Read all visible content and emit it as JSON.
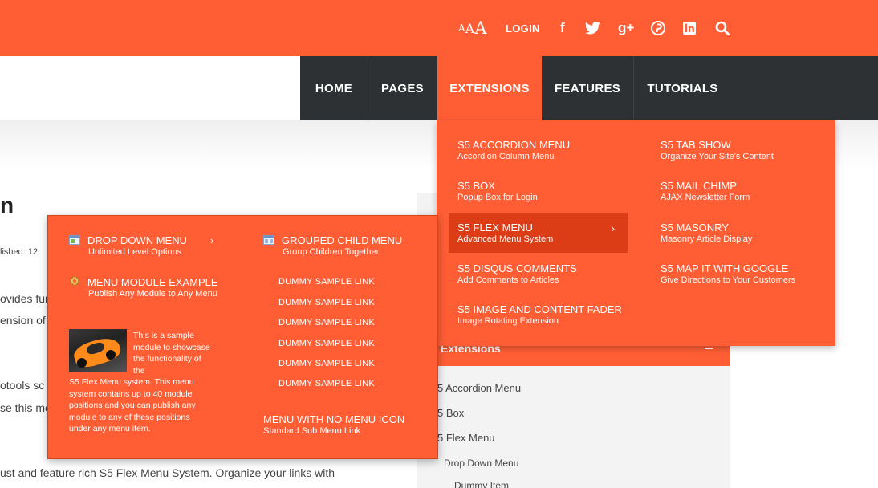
{
  "topbar": {
    "font_size": {
      "small": "A",
      "medium": "A",
      "large": "A"
    },
    "login": "LOGIN",
    "social_icons": [
      "facebook-icon",
      "twitter-icon",
      "google-plus-icon",
      "pinterest-icon",
      "linkedin-icon",
      "search-icon"
    ],
    "glyphs": {
      "facebook": "f",
      "twitter": "🐦",
      "google": "g+",
      "pinterest": "ⓟ",
      "linkedin": "in",
      "search": "⚲"
    }
  },
  "nav": {
    "items": [
      "HOME",
      "PAGES",
      "EXTENSIONS",
      "FEATURES",
      "TUTORIALS"
    ],
    "active": "EXTENSIONS"
  },
  "page": {
    "heading_fragment": "n",
    "published": "lished: 12",
    "line1": "ovides fun",
    "line2": "ension of",
    "line3": "otools sc",
    "line4": "se this me",
    "line5": "ust and feature rich S5 Flex Menu System. Organize your links with"
  },
  "sidebar": {
    "header": "Extensions",
    "links": [
      "5 Accordion Menu",
      "5 Box",
      "5 Flex Menu",
      "Drop Down Menu",
      "Dummy Item"
    ]
  },
  "dropdown": {
    "left": [
      {
        "title": "S5 Accordion Menu",
        "sub": "Accordion Column Menu"
      },
      {
        "title": "S5 Box",
        "sub": "Popup Box for Login"
      },
      {
        "title": "S5 Flex Menu",
        "sub": "Advanced Menu System"
      },
      {
        "title": "S5 Disqus Comments",
        "sub": "Add Comments to Articles"
      },
      {
        "title": "S5 Image and Content Fader",
        "sub": "Image Rotating Extension"
      }
    ],
    "right": [
      {
        "title": "S5 Tab Show",
        "sub": "Organize Your Site's Content"
      },
      {
        "title": "S5 Mail Chimp",
        "sub": "AJAX Newsletter Form"
      },
      {
        "title": "S5 Masonry",
        "sub": "Masonry Article Display"
      },
      {
        "title": "S5 Map It With Google",
        "sub": "Give Directions to Your Customers"
      }
    ],
    "arrow": "›"
  },
  "submenu": {
    "drop_down": {
      "title": "Drop Down Menu",
      "sub": "Unlimited Level Options",
      "arrow": "›"
    },
    "module_example": {
      "title": "Menu Module Example",
      "sub": "Publish Any Module to Any Menu"
    },
    "sample_text_top": "This is a sample module to showcase the functionality of the",
    "sample_text_bottom": "S5 Flex Menu system. This menu system contains up to 40 module positions and you can publish any module to any of these positions under any menu item.",
    "grouped": {
      "title": "Grouped Child Menu",
      "sub": "Group Children Together"
    },
    "dummy_links": [
      "DUMMY SAMPLE LINK",
      "DUMMY SAMPLE LINK",
      "DUMMY SAMPLE LINK",
      "DUMMY SAMPLE LINK",
      "DUMMY SAMPLE LINK",
      "DUMMY SAMPLE LINK"
    ],
    "no_icon": {
      "title": "Menu With No Menu Icon",
      "sub": "Standard Sub Menu Link"
    }
  }
}
